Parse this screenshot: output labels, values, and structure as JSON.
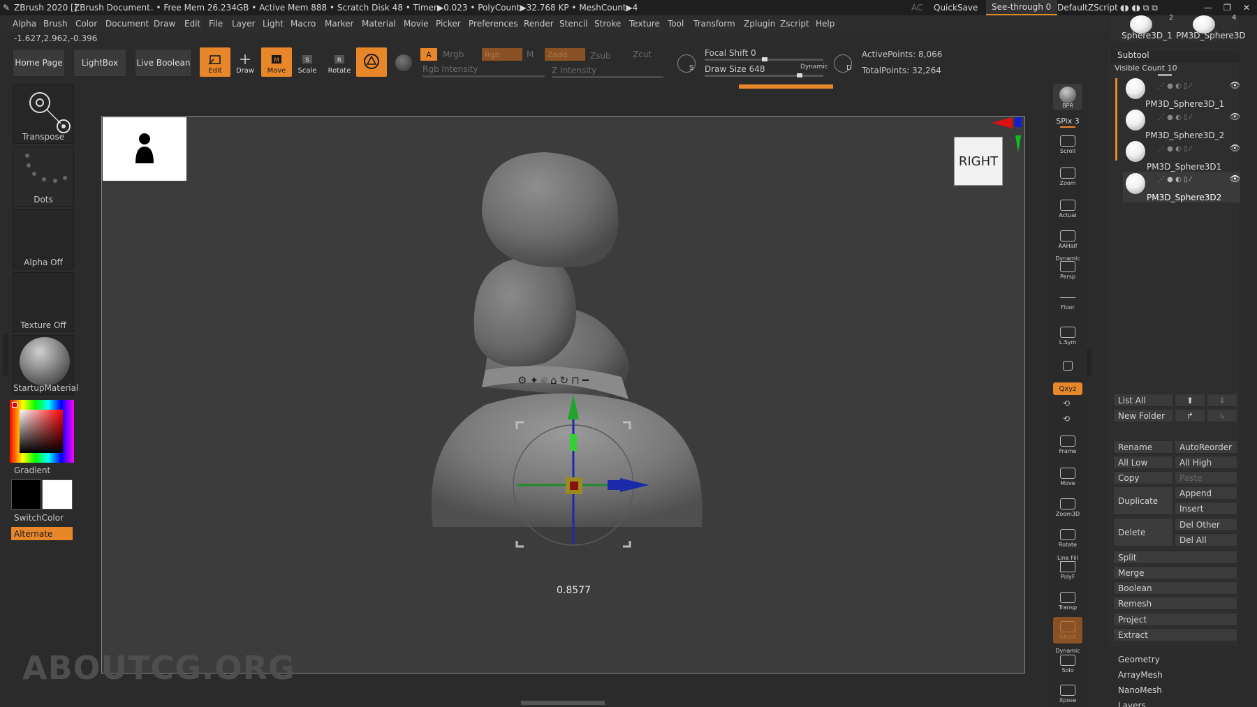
{
  "titlebar": {
    "app": "ZBrush 2020 []",
    "document": "ZBrush Document",
    "stats": ".. • Free Mem 26.234GB • Active Mem 888 • Scratch Disk 48 • Timer▶0.023 • PolyCount▶32.768 KP • MeshCount▶4",
    "ac": "AC",
    "quicksave": "QuickSave",
    "see_through": "See-through  0",
    "default_zscript": "DefaultZScript"
  },
  "menu": [
    "Alpha",
    "Brush",
    "Color",
    "Document",
    "Draw",
    "Edit",
    "File",
    "Layer",
    "Light",
    "Macro",
    "Marker",
    "Material",
    "Movie",
    "Picker",
    "Preferences",
    "Render",
    "Stencil",
    "Stroke",
    "Texture",
    "Tool",
    "Transform",
    "Zplugin",
    "Zscript",
    "Help"
  ],
  "coords": "-1.627,2.962,-0.396",
  "toolbar": {
    "home_page": "Home Page",
    "lightbox": "LightBox",
    "live_boolean": "Live Boolean",
    "edit": "Edit",
    "draw": "Draw",
    "move": "Move",
    "scale": "Scale",
    "rotate": "Rotate",
    "a": "A",
    "mrgb": "Mrgb",
    "rgb": "Rgb",
    "m": "M",
    "zadd": "Zadd",
    "zsub": "Zsub",
    "zcut": "Zcut",
    "rgb_intensity": "Rgb Intensity",
    "z_intensity": "Z Intensity",
    "focal_shift": "Focal Shift 0",
    "draw_size": "Draw Size 648",
    "dynamic": "Dynamic",
    "active_points": "ActivePoints: 8,066",
    "total_points": "TotalPoints: 32,264",
    "s_label": "S",
    "d_label": "D"
  },
  "left_shelf": {
    "transpose": "Transpose",
    "dots": "Dots",
    "alpha_off": "Alpha Off",
    "texture_off": "Texture Off",
    "material": "StartupMaterial",
    "gradient": "Gradient",
    "switch_color": "SwitchColor",
    "alternate": "Alternate"
  },
  "canvas": {
    "nav_label": "RIGHT",
    "readout": "0.8577",
    "watermark": "ABOUTCG.ORG"
  },
  "right_shelf": [
    "BPR",
    "SPix 3",
    "Scroll",
    "Zoom",
    "Actual",
    "AAHalf",
    "Persp",
    "Floor",
    "L.Sym",
    "Qxyz",
    "Frame",
    "Move",
    "Zoom3D",
    "Rotate",
    "PolyF",
    "Transp",
    "Ghost",
    "Solo",
    "Xpose"
  ],
  "right_shelf_extra": {
    "dynamic": "Dynamic",
    "line_fill": "Line Fill"
  },
  "top_thumbs": {
    "left_name": "Sphere3D_1",
    "right_name": "PM3D_Sphere3D",
    "left_count": "2",
    "right_count": "4"
  },
  "subtool": {
    "title": "Subtool",
    "visible_count": "Visible Count 10",
    "items": [
      "PM3D_Sphere3D_1",
      "PM3D_Sphere3D_2",
      "PM3D_Sphere3D1",
      "PM3D_Sphere3D2"
    ],
    "list_all": "List All",
    "new_folder": "New Folder",
    "rename": "Rename",
    "auto_reorder": "AutoReorder",
    "all_low": "All Low",
    "all_high": "All High",
    "copy": "Copy",
    "paste": "Paste",
    "duplicate": "Duplicate",
    "append": "Append",
    "insert": "Insert",
    "delete": "Delete",
    "del_other": "Del Other",
    "del_all": "Del All",
    "split": "Split",
    "merge": "Merge",
    "boolean": "Boolean",
    "remesh": "Remesh",
    "project": "Project",
    "extract": "Extract"
  },
  "sections": [
    "Geometry",
    "ArrayMesh",
    "NanoMesh",
    "Layers"
  ],
  "colors": {
    "accent": "#e8872a",
    "canvas": "#3c3c3c",
    "panel": "#2e2e2e"
  }
}
